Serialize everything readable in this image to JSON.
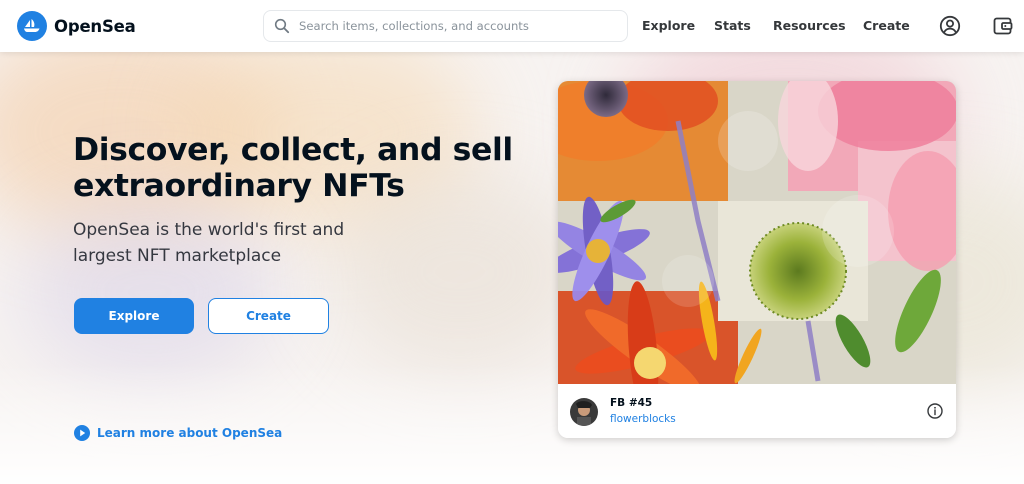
{
  "brand": {
    "name": "OpenSea",
    "logo_icon": "opensea-sailboat-icon",
    "accent": "#2081e2"
  },
  "search": {
    "placeholder": "Search items, collections, and accounts",
    "value": ""
  },
  "nav": {
    "links": [
      {
        "label": "Explore"
      },
      {
        "label": "Stats"
      },
      {
        "label": "Resources"
      },
      {
        "label": "Create"
      }
    ],
    "icons": [
      "account-icon",
      "wallet-icon"
    ]
  },
  "hero": {
    "headline": "Discover, collect, and sell extraordinary NFTs",
    "subhead": "OpenSea is the world's first and largest NFT marketplace",
    "primary_button": "Explore",
    "secondary_button": "Create",
    "learn_more": "Learn more about OpenSea"
  },
  "featured": {
    "title": "FB #45",
    "creator": "flowerblocks"
  }
}
